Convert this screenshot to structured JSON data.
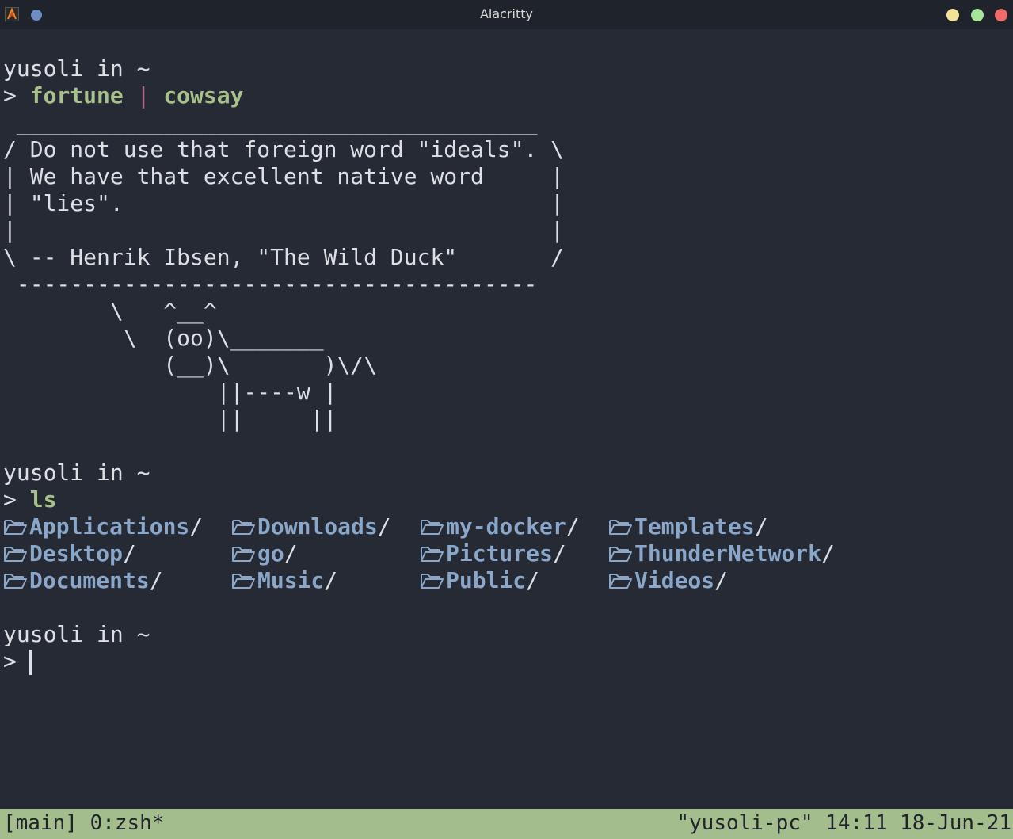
{
  "window": {
    "title": "Alacritty",
    "colors": {
      "menu_dot": "#6e8cc6",
      "minimize": "#f2e39a",
      "maximize": "#a7e59a",
      "close": "#f26b6b"
    }
  },
  "terminal": {
    "prompt1": {
      "user_line": "yusoli in ~",
      "symbol": "> ",
      "cmd1": "fortune",
      "pipe": " | ",
      "cmd2": "cowsay"
    },
    "cowsay": [
      " _______________________________________",
      "/ Do not use that foreign word \"ideals\". \\",
      "| We have that excellent native word     |",
      "| \"lies\".                                |",
      "|                                        |",
      "\\ -- Henrik Ibsen, \"The Wild Duck\"       /",
      " ---------------------------------------",
      "        \\   ^__^",
      "         \\  (oo)\\_______",
      "            (__)\\       )\\/\\",
      "                ||----w |",
      "                ||     ||"
    ],
    "prompt2": {
      "user_line": "yusoli in ~",
      "symbol": "> ",
      "cmd": "ls"
    },
    "ls_rows": [
      [
        {
          "name": "Applications",
          "suffix": "/"
        },
        {
          "name": "Downloads",
          "suffix": "/"
        },
        {
          "name": "my-docker",
          "suffix": "/"
        },
        {
          "name": "Templates",
          "suffix": "/"
        }
      ],
      [
        {
          "name": "Desktop",
          "suffix": "/"
        },
        {
          "name": "go",
          "suffix": "/"
        },
        {
          "name": "Pictures",
          "suffix": "/"
        },
        {
          "name": "ThunderNetwork",
          "suffix": "/"
        }
      ],
      [
        {
          "name": "Documents",
          "suffix": "/"
        },
        {
          "name": "Music",
          "suffix": "/"
        },
        {
          "name": "Public",
          "suffix": "/"
        },
        {
          "name": "Videos",
          "suffix": "/"
        }
      ]
    ],
    "prompt3": {
      "user_line": "yusoli in ~",
      "symbol": "> "
    }
  },
  "statusbar": {
    "left": "[main] 0:zsh*",
    "right": "\"yusoli-pc\" 14:11 18-Jun-21",
    "color": "#a3be8c"
  }
}
